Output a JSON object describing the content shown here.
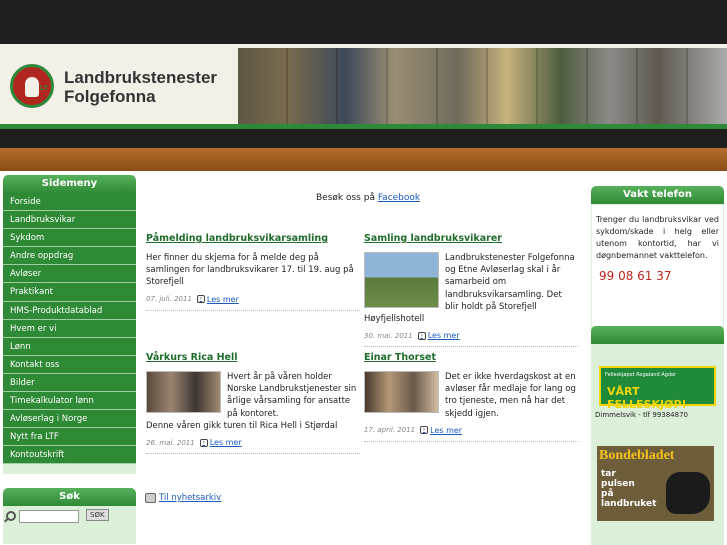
{
  "colors": {
    "accent_green": "#2f8a35",
    "header_band": "#8a4d16",
    "link": "#1a5ab8",
    "phone": "#c0241c"
  },
  "header": {
    "logo_text": "NLT",
    "title_line1": "Landbrukstenester",
    "title_line2": "Folgefonna"
  },
  "sidebar": {
    "heading": "Sidemeny",
    "items": [
      {
        "label": "Forside"
      },
      {
        "label": "Landbruksvikar"
      },
      {
        "label": "Sykdom"
      },
      {
        "label": "Andre oppdrag"
      },
      {
        "label": "Avløser"
      },
      {
        "label": "Praktikant"
      },
      {
        "label": "HMS-Produktdatablad"
      },
      {
        "label": "Hvem er vi"
      },
      {
        "label": "Lønn"
      },
      {
        "label": "Kontakt oss"
      },
      {
        "label": "Bilder"
      },
      {
        "label": "Timekalkulator lønn"
      },
      {
        "label": "Avløserlag i Norge"
      },
      {
        "label": "Nytt fra LTF"
      },
      {
        "label": "Kontoutskrift"
      }
    ]
  },
  "search": {
    "heading": "Søk",
    "button": "SØK",
    "placeholder": ""
  },
  "main": {
    "facebook_prefix": "Besøk oss på",
    "facebook_link": "Facebook",
    "read_more": "Les mer",
    "archive_link": "Til nyhetsarkiv",
    "articles": [
      {
        "title": "Påmelding landbruksvikarsamling",
        "body": "Her finner du skjema for å melde deg på samlingen for landbruksvikarer 17. til 19. aug på Storefjell",
        "date": "07. juli. 2011"
      },
      {
        "title": "Samling landbruksvikarer",
        "body": "Landbrukstenester Folgefonna og Etne Avløserlag skal i år samarbeid om landbruksvikarsamling. Det blir holdt på Storefjell Høyfjellshotell",
        "date": "30. mai. 2011"
      },
      {
        "title": "Vårkurs Rica Hell",
        "body": "Hvert år på våren holder Norske Landbrukstjenester sin årlige vårsamling for ansatte på kontoret.",
        "body2": "Denne våren gikk turen til Rica Hell i Stjørdal",
        "date": "26. mai. 2011"
      },
      {
        "title": "Einar Thorset",
        "body": "Det er ikke hverdagskost at en avløser får medlaje for lang og tro tjeneste, men nå har det skjedd igjen.",
        "date": "17. april. 2011"
      }
    ]
  },
  "right": {
    "vakt_heading": "Vakt telefon",
    "vakt_text": "Trenger du landbruksvikar ved sykdom/skade i helg eller utenom kontortid, har vi døgnbemannet vakttelefon.",
    "phone": "99 08 61 37",
    "ad1_small": "Felleskjøpet Rogaland Agder",
    "ad1_big": "VÅRT FELLESKJØP!",
    "ad1_caption": "Dimmelsvik - tlf 99384870",
    "ad2_title": "Bondebladet",
    "ad2_sub1": "tar",
    "ad2_sub2": "pulsen",
    "ad2_sub3": "på",
    "ad2_sub4": "landbruket"
  }
}
